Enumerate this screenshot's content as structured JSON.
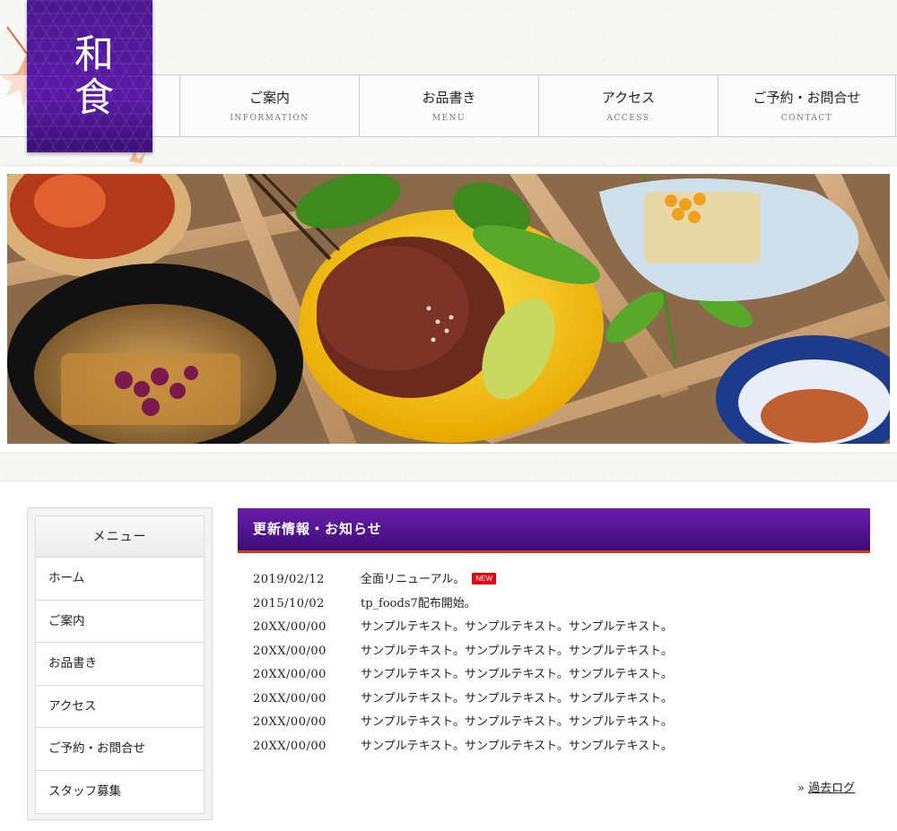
{
  "logo": {
    "text": "和食"
  },
  "nav": {
    "items": [
      {
        "label": "ご案内",
        "sub": "INFORMATION"
      },
      {
        "label": "お品書き",
        "sub": "MENU"
      },
      {
        "label": "アクセス",
        "sub": "ACCESS"
      },
      {
        "label": "ご予約・お問合せ",
        "sub": "CONTACT"
      }
    ]
  },
  "side_menu": {
    "title": "メニュー",
    "items": [
      {
        "label": "ホーム"
      },
      {
        "label": "ご案内"
      },
      {
        "label": "お品書き"
      },
      {
        "label": "アクセス"
      },
      {
        "label": "ご予約・お問合せ"
      },
      {
        "label": "スタッフ募集"
      }
    ]
  },
  "news": {
    "title": "更新情報・お知らせ",
    "badge": "NEW",
    "rows": [
      {
        "date": "2019/02/12",
        "text": "全面リニューアル。"
      },
      {
        "date": "2015/10/02",
        "text": "tp_foods7配布開始。"
      },
      {
        "date": "20XX/00/00",
        "text": "サンプルテキスト。サンプルテキスト。サンプルテキスト。"
      },
      {
        "date": "20XX/00/00",
        "text": "サンプルテキスト。サンプルテキスト。サンプルテキスト。"
      },
      {
        "date": "20XX/00/00",
        "text": "サンプルテキスト。サンプルテキスト。サンプルテキスト。"
      },
      {
        "date": "20XX/00/00",
        "text": "サンプルテキスト。サンプルテキスト。サンプルテキスト。"
      },
      {
        "date": "20XX/00/00",
        "text": "サンプルテキスト。サンプルテキスト。サンプルテキスト。"
      },
      {
        "date": "20XX/00/00",
        "text": "サンプルテキスト。サンプルテキスト。サンプルテキスト。"
      }
    ],
    "archive_prefix": "»",
    "archive_label": "過去ログ"
  },
  "colors": {
    "brand_purple": "#5b1aa6",
    "accent_red": "#d23a1e",
    "badge_red": "#e60012"
  }
}
